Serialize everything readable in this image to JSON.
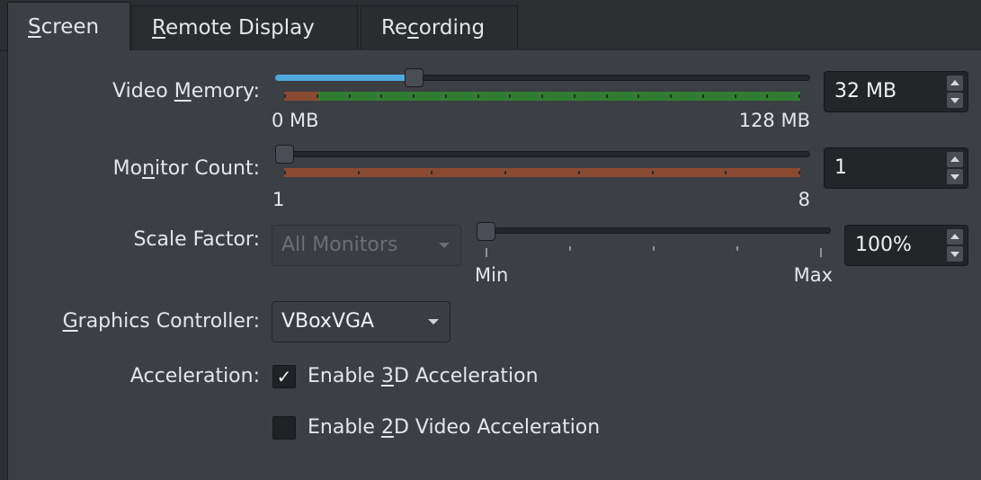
{
  "tabs": [
    {
      "pre": "",
      "u": "S",
      "post": "creen",
      "active": true
    },
    {
      "pre": "",
      "u": "R",
      "post": "emote Display",
      "active": false
    },
    {
      "pre": "Re",
      "u": "c",
      "post": "ording",
      "active": false
    }
  ],
  "video_memory": {
    "label_pre": "Video ",
    "label_u": "M",
    "label_post": "emory:",
    "min_label": "0 MB",
    "max_label": "128 MB",
    "slider_fraction": 0.25,
    "spin_value": "32 MB"
  },
  "monitor_count": {
    "label_pre": "Mo",
    "label_u": "n",
    "label_post": "itor Count:",
    "min_label": "1",
    "max_label": "8",
    "slider_fraction": 0.0,
    "spin_value": "1"
  },
  "scale_factor": {
    "label": "Scale Factor:",
    "combo_value": "All Monitors",
    "min_label": "Min",
    "max_label": "Max",
    "slider_fraction": 0.0,
    "spin_value": "100%"
  },
  "graphics_controller": {
    "label_pre": "",
    "label_u": "G",
    "label_post": "raphics Controller:",
    "value": "VBoxVGA"
  },
  "acceleration": {
    "label": "Acceleration:",
    "opt3d": {
      "pre": "Enable ",
      "u": "3",
      "post": "D Acceleration",
      "checked": true,
      "mark": "✓"
    },
    "opt2d": {
      "pre": "Enable ",
      "u": "2",
      "post": "D Video Acceleration",
      "checked": false
    }
  },
  "colors": {
    "accent": "#4ea8dc",
    "bar_green": "#2f7d32",
    "bar_red": "#8a4a32",
    "background": "#3c3f44"
  }
}
